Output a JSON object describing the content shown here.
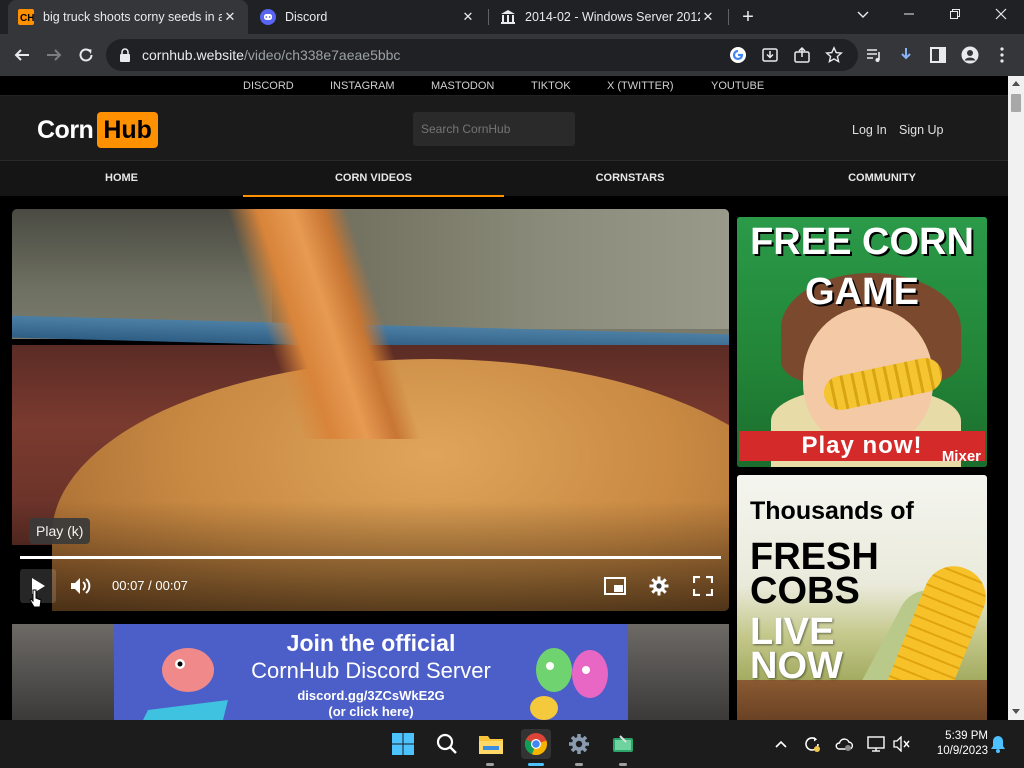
{
  "browser": {
    "tabs": [
      {
        "title": "big truck shoots corny seeds in a",
        "active": true
      },
      {
        "title": "Discord",
        "active": false
      },
      {
        "title": "2014-02 - Windows Server 2012",
        "active": false
      }
    ],
    "url_host": "cornhub.website",
    "url_path": "/video/ch338e7aeae5bbc"
  },
  "site": {
    "social_links": [
      "DISCORD",
      "INSTAGRAM",
      "MASTODON",
      "TIKTOK",
      "X (TWITTER)",
      "YOUTUBE"
    ],
    "logo_word": "Corn",
    "logo_badge": "Hub",
    "logo_color": "#ff9000",
    "search_placeholder": "Search CornHub",
    "login": "Log In",
    "signup": "Sign Up",
    "nav": [
      {
        "label": "HOME",
        "active": false
      },
      {
        "label": "CORN VIDEOS",
        "active": true
      },
      {
        "label": "CORNSTARS",
        "active": false
      },
      {
        "label": "COMMUNITY",
        "active": false
      }
    ]
  },
  "video": {
    "tooltip": "Play (k)",
    "time": "00:07 / 00:07",
    "progress": 1.0
  },
  "banner": {
    "line1": "Join the official",
    "line2": "CornHub Discord Server",
    "line3": "discord.gg/3ZCsWkE2G",
    "line4": "(or click here)"
  },
  "ads": {
    "ad1_line1": "FREE CORN",
    "ad1_line2": "GAME",
    "ad1_cta": "Play now!",
    "ad1_brand": "Mixer",
    "ad2_line1": "Thousands of",
    "ad2_line2": "FRESH COBS",
    "ad2_line3": "LIVE NOW"
  },
  "taskbar": {
    "time": "5:39 PM",
    "date": "10/9/2023"
  }
}
